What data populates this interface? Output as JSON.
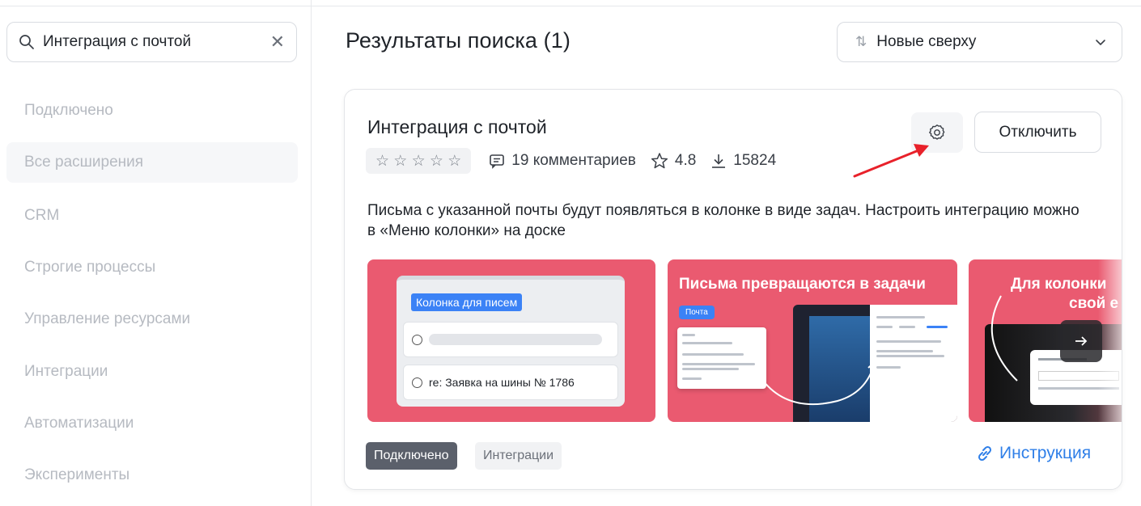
{
  "sidebar": {
    "search": {
      "value": "Интеграция с почтой",
      "clear_label": "✕"
    },
    "items": [
      {
        "label": "Подключено"
      },
      {
        "label": "Все расширения"
      },
      {
        "label": "CRM"
      },
      {
        "label": "Строгие процессы"
      },
      {
        "label": "Управление ресурсами"
      },
      {
        "label": "Интеграции"
      },
      {
        "label": "Автоматизации"
      },
      {
        "label": "Эксперименты"
      }
    ],
    "active_item": "Все расширения"
  },
  "main": {
    "title": "Результаты поиска (1)",
    "sort": {
      "label": "Новые сверху",
      "icon": "sort-icon"
    }
  },
  "result": {
    "title": "Интеграция с почтой",
    "stars": "☆ ☆ ☆ ☆ ☆",
    "comments": "19 комментариев",
    "rating": "4.8",
    "downloads": "15824",
    "disconnect_label": "Отключить",
    "description": "Письма с указанной почты будут появляться в колонке в виде задач. Настроить интеграцию можно в «Меню колонки» на доске",
    "slides": {
      "s1_badge": "Колонка для писем",
      "s1_row": "re: Заявка на шины № 1786",
      "s2_heading": "Письма превращаются в задачи",
      "s2_badge": "Почта",
      "s3_heading": "Для колонки",
      "s3_heading2": "свой е"
    },
    "tags": [
      "Подключено",
      "Интеграции"
    ],
    "instruction_label": "Инструкция"
  },
  "colors": {
    "accent": "#2f7fe8",
    "slide_bg": "#ea5a70",
    "annotation_arrow": "#e8212a"
  }
}
